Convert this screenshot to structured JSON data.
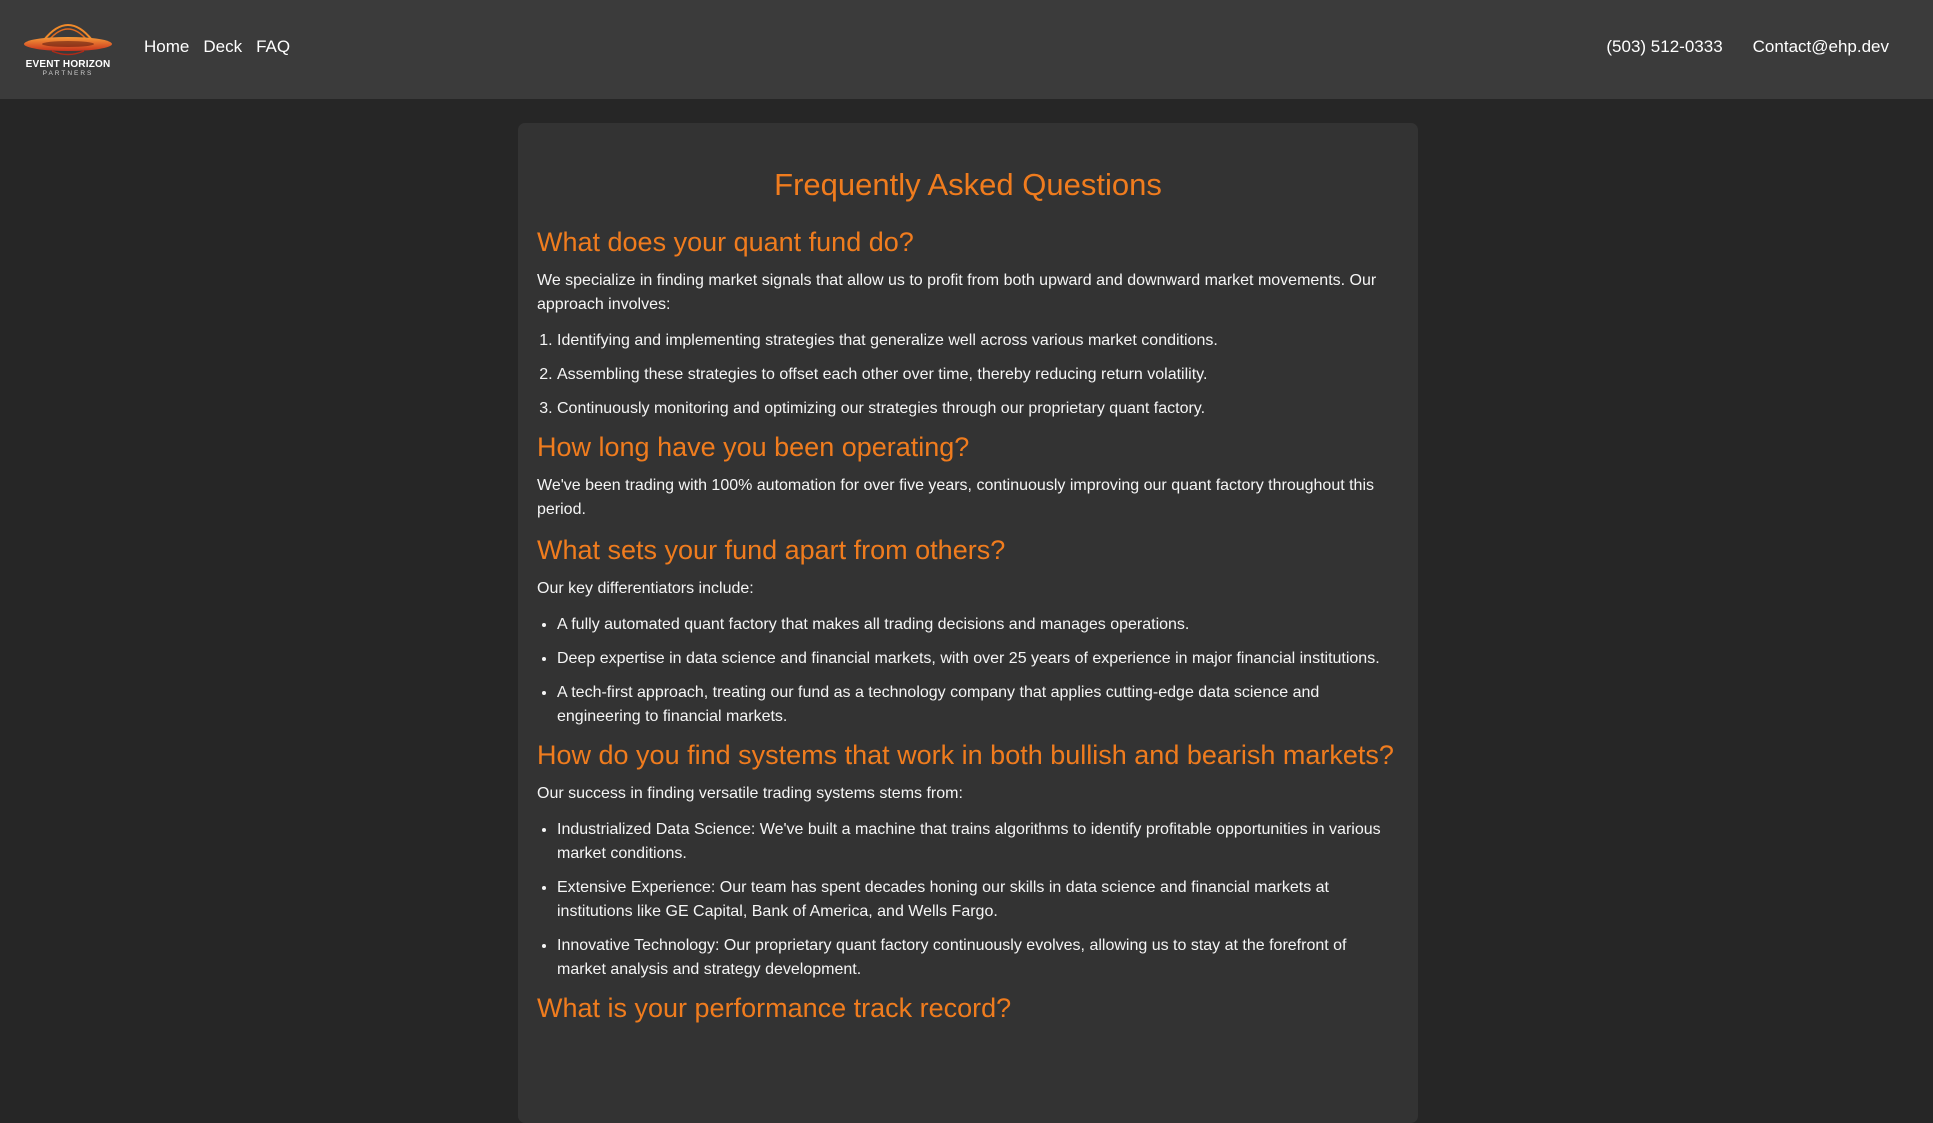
{
  "header": {
    "logo_title": "EVENT HORIZON",
    "logo_subtitle": "PARTNERS",
    "nav": [
      "Home",
      "Deck",
      "FAQ"
    ],
    "phone": "(503) 512-0333",
    "email": "Contact@ehp.dev"
  },
  "colors": {
    "accent": "#f07c1e",
    "header_bg": "#3b3b3b",
    "page_bg": "#262626",
    "card_bg": "#333333"
  },
  "faq": {
    "title": "Frequently Asked Questions",
    "sections": [
      {
        "question": "What does your quant fund do?",
        "intro": "We specialize in finding market signals that allow us to profit from both upward and downward market movements. Our approach involves:",
        "list_type": "ordered",
        "items": [
          "Identifying and implementing strategies that generalize well across various market conditions.",
          "Assembling these strategies to offset each other over time, thereby reducing return volatility.",
          "Continuously monitoring and optimizing our strategies through our proprietary quant factory."
        ]
      },
      {
        "question": "How long have you been operating?",
        "intro": "We've been trading with 100% automation for over five years, continuously improving our quant factory throughout this period.",
        "list_type": "none",
        "items": []
      },
      {
        "question": "What sets your fund apart from others?",
        "intro": "Our key differentiators include:",
        "list_type": "unordered",
        "items": [
          "A fully automated quant factory that makes all trading decisions and manages operations.",
          "Deep expertise in data science and financial markets, with over 25 years of experience in major financial institutions.",
          "A tech-first approach, treating our fund as a technology company that applies cutting-edge data science and engineering to financial markets."
        ]
      },
      {
        "question": "How do you find systems that work in both bullish and bearish markets?",
        "intro": "Our success in finding versatile trading systems stems from:",
        "list_type": "unordered",
        "items": [
          "Industrialized Data Science: We've built a machine that trains algorithms to identify profitable opportunities in various market conditions.",
          "Extensive Experience: Our team has spent decades honing our skills in data science and financial markets at institutions like GE Capital, Bank of America, and Wells Fargo.",
          "Innovative Technology: Our proprietary quant factory continuously evolves, allowing us to stay at the forefront of market analysis and strategy development."
        ]
      },
      {
        "question": "What is your performance track record?",
        "intro": "",
        "list_type": "none",
        "items": []
      }
    ]
  }
}
